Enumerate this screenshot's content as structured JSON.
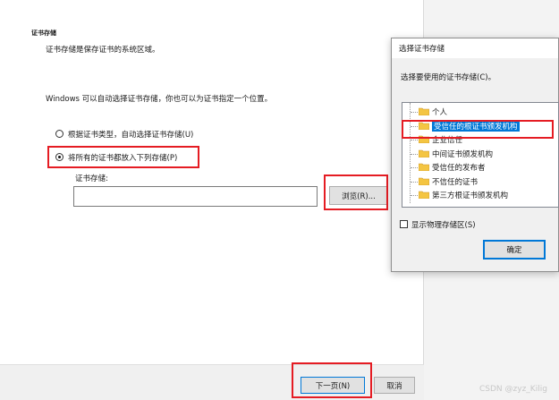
{
  "wizard": {
    "section_title": "证书存储",
    "section_desc": "证书存储是保存证书的系统区域。",
    "intro": "Windows 可以自动选择证书存储，你也可以为证书指定一个位置。",
    "radio_auto_label": "根据证书类型，自动选择证书存储(U)",
    "radio_manual_label": "将所有的证书都放入下列存储(P)",
    "store_label": "证书存储:",
    "store_value": "",
    "browse_button": "浏览(R)...",
    "next_button": "下一页(N)",
    "cancel_button": "取消"
  },
  "dialog": {
    "title": "选择证书存储",
    "prompt": "选择要使用的证书存储(C)。",
    "tree_items": [
      "个人",
      "受信任的根证书颁发机构",
      "企业信任",
      "中间证书颁发机构",
      "受信任的发布者",
      "不信任的证书",
      "第三方根证书颁发机构"
    ],
    "selected_index": 1,
    "show_physical_label": "显示物理存储区(S)",
    "show_physical_checked": false,
    "ok_button": "确定"
  },
  "watermark": "CSDN @zyz_Kilig",
  "colors": {
    "highlight_red": "#e51c23",
    "selection_blue": "#0078d7",
    "folder_yellow": "#f4c542"
  },
  "icons": {
    "folder": "folder-icon",
    "radio": "radio-button",
    "checkbox": "checkbox"
  }
}
